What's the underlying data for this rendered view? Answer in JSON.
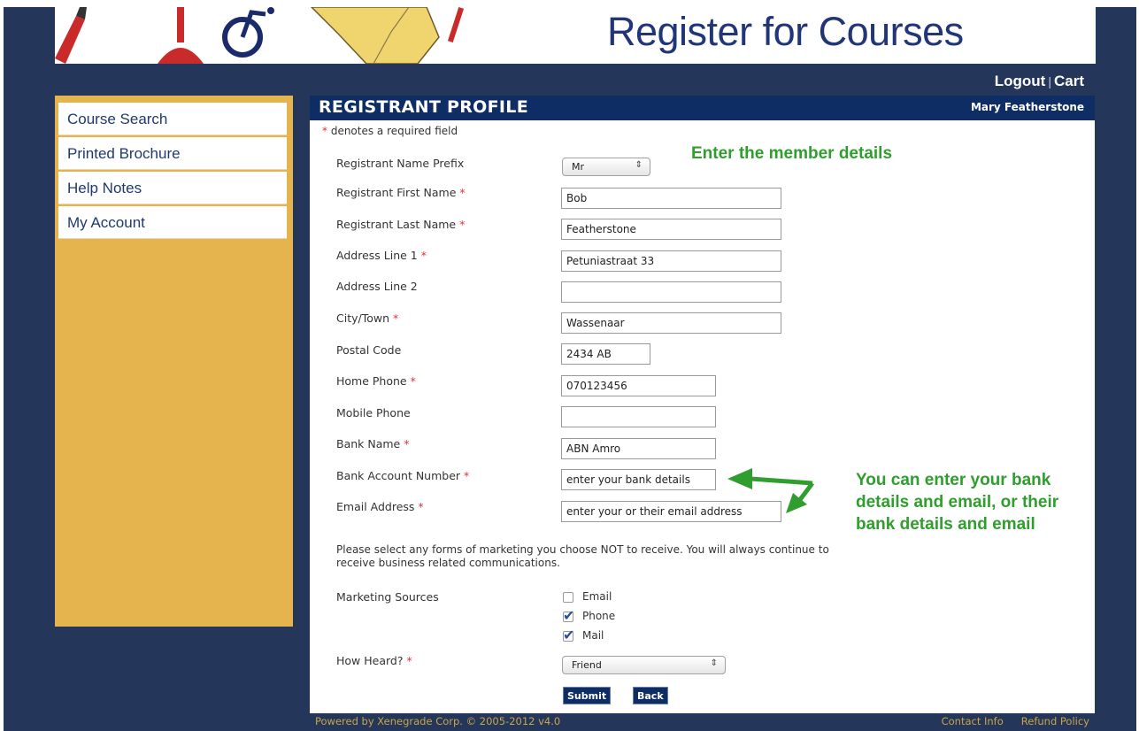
{
  "banner": {
    "title": "Register for Courses"
  },
  "top_nav": {
    "logout": "Logout",
    "separator": "|",
    "cart": "Cart"
  },
  "sidebar": {
    "items": [
      {
        "label": "Course Search"
      },
      {
        "label": "Printed Brochure"
      },
      {
        "label": "Help Notes"
      },
      {
        "label": "My Account"
      }
    ]
  },
  "profile": {
    "title": "REGISTRANT PROFILE",
    "user_name": "Mary Featherstone",
    "required_note": "denotes a required field",
    "required_marker": "*"
  },
  "form": {
    "prefix": {
      "label": "Registrant Name Prefix",
      "value": "Mr"
    },
    "first_name": {
      "label": "Registrant First Name",
      "value": "Bob"
    },
    "last_name": {
      "label": "Registrant Last Name",
      "value": "Featherstone"
    },
    "address1": {
      "label": "Address Line 1",
      "value": "Petuniastraat 33"
    },
    "address2": {
      "label": "Address Line 2",
      "value": ""
    },
    "city": {
      "label": "City/Town",
      "value": "Wassenaar"
    },
    "postal_code": {
      "label": "Postal Code",
      "value": "2434 AB"
    },
    "home_phone": {
      "label": "Home Phone",
      "value": "070123456"
    },
    "mobile_phone": {
      "label": "Mobile Phone",
      "value": ""
    },
    "bank_name": {
      "label": "Bank Name",
      "value": "ABN Amro"
    },
    "bank_account": {
      "label": "Bank Account Number",
      "value": "enter your bank details"
    },
    "email": {
      "label": "Email Address",
      "value": "enter your or their email address"
    },
    "marketing_note": "Please select any forms of marketing you choose NOT to receive. You will always continue to receive business related communications.",
    "marketing_sources": {
      "label": "Marketing Sources",
      "options": [
        {
          "label": "Email",
          "checked": false
        },
        {
          "label": "Phone",
          "checked": true
        },
        {
          "label": "Mail",
          "checked": true
        }
      ]
    },
    "how_heard": {
      "label": "How Heard?",
      "value": "Friend"
    },
    "submit_label": "Submit",
    "back_label": "Back"
  },
  "annotations": {
    "member_details": "Enter the member details",
    "bank_lines": [
      "You can enter your bank",
      "details and email, or their",
      "bank details and email"
    ],
    "color": "#2f9e2e"
  },
  "footer": {
    "powered_by": "Powered by Xenegrade Corp. © 2005-2012 v4.0",
    "contact": "Contact Info",
    "refund": "Refund Policy"
  }
}
